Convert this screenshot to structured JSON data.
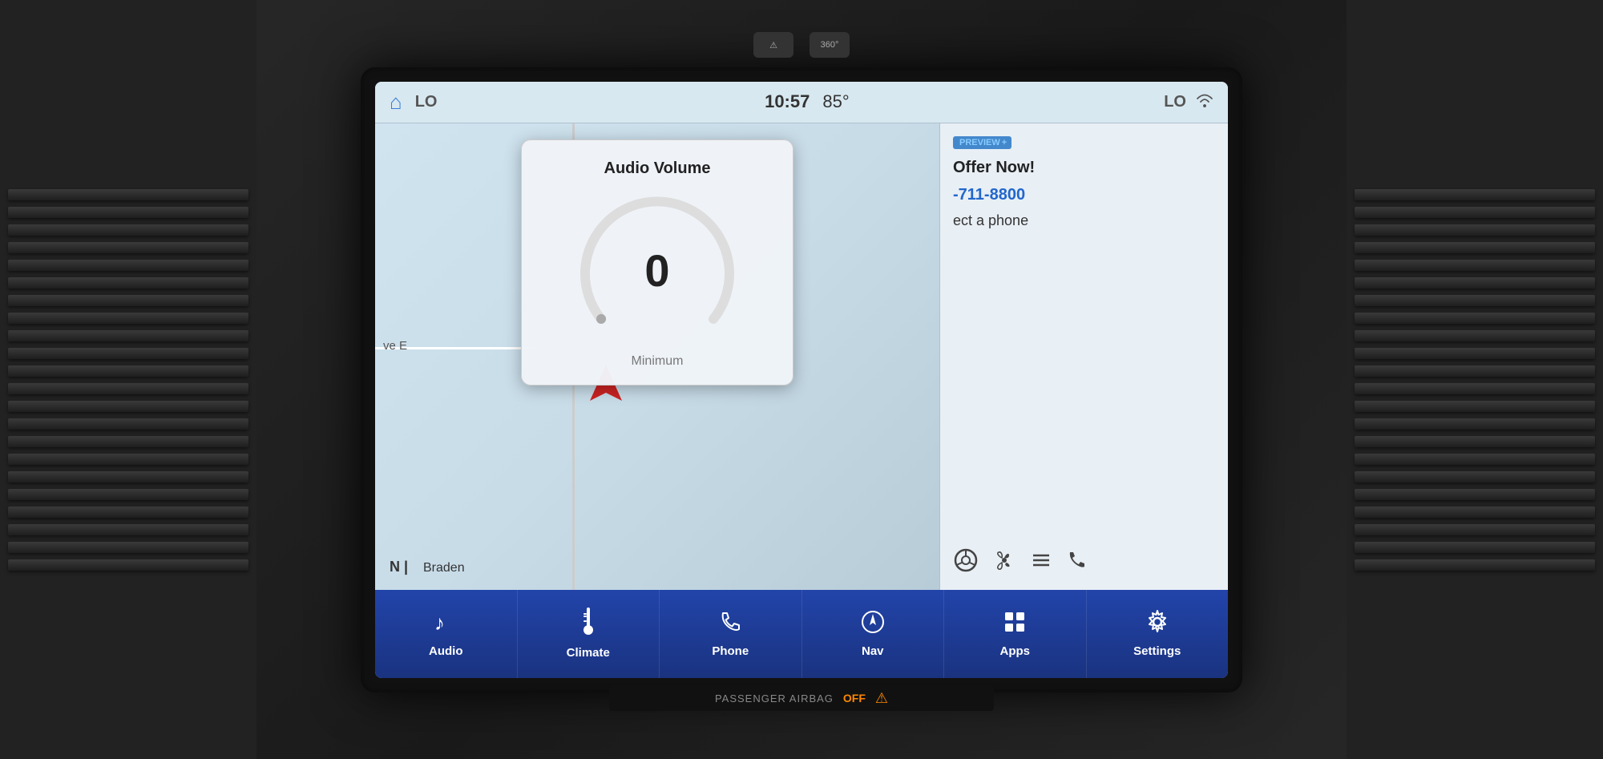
{
  "car": {
    "background_color": "#1a1a1a"
  },
  "status_bar": {
    "home_icon": "⌂",
    "lo_left": "LO",
    "time": "10:57",
    "temperature": "85°",
    "lo_right": "LO",
    "wifi_icon": "wifi"
  },
  "map": {
    "direction_label": "N",
    "street_label": "Braden",
    "avenue_label": "ve E",
    "arrow_color": "#cc2222"
  },
  "right_panel": {
    "preview_label": "PREVIEW",
    "preview_plus": "+",
    "offer_line1": "Offer Now!",
    "phone": "-711-8800",
    "connect": "ect a phone"
  },
  "audio_volume": {
    "title": "Audio Volume",
    "value": "0",
    "minimum_label": "Minimum"
  },
  "bottom_nav": {
    "items": [
      {
        "id": "audio",
        "icon": "♪",
        "label": "Audio"
      },
      {
        "id": "climate",
        "icon": "thermometer",
        "label": "Climate"
      },
      {
        "id": "phone",
        "icon": "phone",
        "label": "Phone"
      },
      {
        "id": "nav",
        "icon": "nav",
        "label": "Nav"
      },
      {
        "id": "apps",
        "icon": "apps",
        "label": "Apps"
      },
      {
        "id": "settings",
        "icon": "gear",
        "label": "Settings"
      }
    ]
  },
  "airbag": {
    "label": "PASSENGER AIRBAG",
    "status": "OFF"
  },
  "top_buttons": {
    "warning_label": "⚠",
    "camera_label": "360°"
  }
}
